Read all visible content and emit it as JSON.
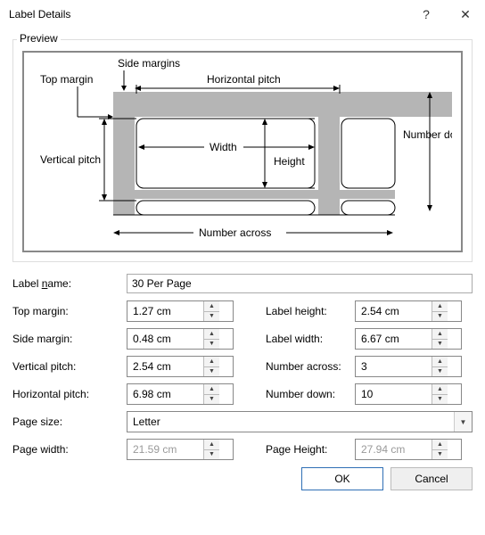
{
  "title": "Label Details",
  "preview_legend": "Preview",
  "diagram": {
    "side_margins": "Side margins",
    "top_margin": "Top margin",
    "horizontal_pitch": "Horizontal pitch",
    "number_down": "Number down",
    "vertical_pitch": "Vertical pitch",
    "width": "Width",
    "height": "Height",
    "number_across": "Number across"
  },
  "fields": {
    "label_name": {
      "label_pre": "Label ",
      "ul": "n",
      "label_post": "ame:",
      "value": "30 Per Page"
    },
    "top_margin": {
      "ul": "T",
      "label_post": "op margin:",
      "value": "1.27 cm"
    },
    "side_margin": {
      "ul": "S",
      "label_post": "ide margin:",
      "value": "0.48 cm"
    },
    "vertical_pitch": {
      "ul": "V",
      "label_post": "ertical pitch:",
      "value": "2.54 cm"
    },
    "horizontal_pitch": {
      "label_pre": "H",
      "ul": "o",
      "label_post": "rizontal pitch:",
      "value": "6.98 cm"
    },
    "label_height": {
      "label_pre": "Label h",
      "ul": "e",
      "label_post": "ight:",
      "value": "2.54 cm"
    },
    "label_width": {
      "label_pre": "Label ",
      "ul": "w",
      "label_post": "idth:",
      "value": "6.67 cm"
    },
    "number_across": {
      "label_pre": "Number a",
      "ul": "c",
      "label_post": "ross:",
      "value": "3"
    },
    "number_down": {
      "label_pre": "Number ",
      "ul": "d",
      "label_post": "own:",
      "value": "10"
    },
    "page_size": {
      "label": "Page size:",
      "value": "Letter"
    },
    "page_width": {
      "ul": "P",
      "label_post": "age width:",
      "value": "21.59 cm"
    },
    "page_height": {
      "label_pre": "Page ",
      "ul": "H",
      "label_post": "eight:",
      "value": "27.94 cm"
    }
  },
  "buttons": {
    "ok": "OK",
    "cancel": "Cancel"
  },
  "icons": {
    "help": "?",
    "close": "✕",
    "up": "▲",
    "down": "▼",
    "caret": "▼"
  }
}
